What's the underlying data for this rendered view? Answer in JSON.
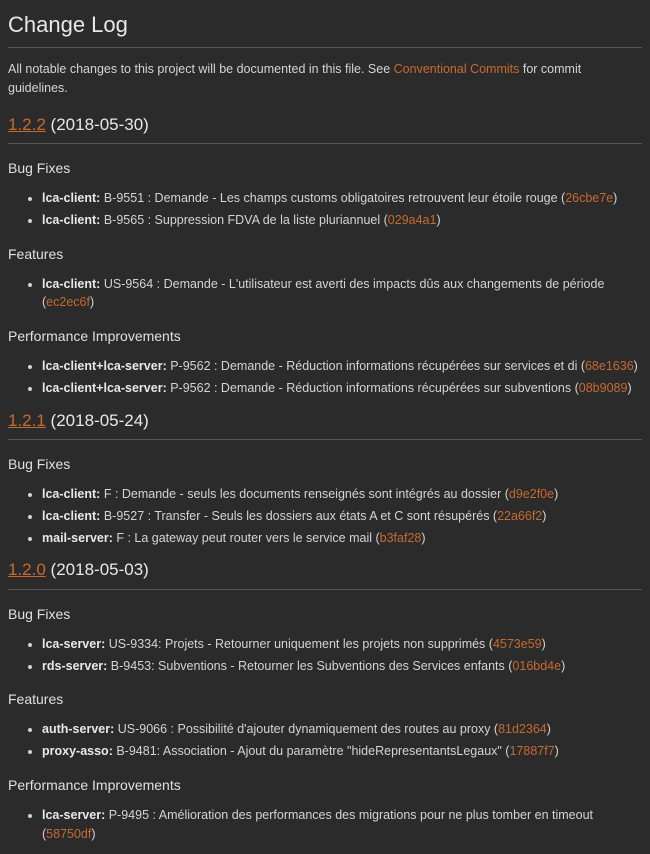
{
  "page_title": "Change Log",
  "intro": {
    "prefix": "All notable changes to this project will be documented in this file. See ",
    "link_label": "Conventional Commits",
    "suffix": " for commit guidelines."
  },
  "sections": {
    "bug_fixes": "Bug Fixes",
    "features": "Features",
    "perf": "Performance Improvements"
  },
  "releases": [
    {
      "version": "1.2.2",
      "date": "(2018-05-30)",
      "bug_fixes": [
        {
          "scope": "lca-client:",
          "text": " B-9551 : Demande - Les champs customs obligatoires retrouvent leur étoile rouge (",
          "hash": "26cbe7e",
          "close": ")"
        },
        {
          "scope": "lca-client:",
          "text": " B-9565 : Suppression FDVA de la liste pluriannuel (",
          "hash": "029a4a1",
          "close": ")"
        }
      ],
      "features": [
        {
          "scope": "lca-client:",
          "text": " US-9564 : Demande - L'utilisateur est averti des impacts dûs aux changements de période (",
          "hash": "ec2ec6f",
          "close": ")"
        }
      ],
      "perf": [
        {
          "scope": "lca-client+lca-server:",
          "text": " P-9562 : Demande - Réduction informations récupérées sur services et di (",
          "hash": "68e1636",
          "close": ")"
        },
        {
          "scope": "lca-client+lca-server:",
          "text": " P-9562 : Demande - Réduction informations récupérées sur subventions (",
          "hash": "08b9089",
          "close": ")"
        }
      ]
    },
    {
      "version": "1.2.1",
      "date": "(2018-05-24)",
      "bug_fixes": [
        {
          "scope": "lca-client:",
          "text": " F : Demande - seuls les documents renseignés sont intégrés au dossier (",
          "hash": "d9e2f0e",
          "close": ")"
        },
        {
          "scope": "lca-client:",
          "text": " B-9527 : Transfer - Seuls les dossiers aux états A et C sont résupérés (",
          "hash": "22a66f2",
          "close": ")"
        },
        {
          "scope": "mail-server:",
          "text": " F : La gateway peut router vers le service mail (",
          "hash": "b3faf28",
          "close": ")"
        }
      ]
    },
    {
      "version": "1.2.0",
      "date": "(2018-05-03)",
      "bug_fixes": [
        {
          "scope": "lca-server:",
          "text": " US-9334: Projets - Retourner uniquement les projets non supprimés (",
          "hash": "4573e59",
          "close": ")"
        },
        {
          "scope": "rds-server:",
          "text": " B-9453: Subventions - Retourner les Subventions des Services enfants (",
          "hash": "016bd4e",
          "close": ")"
        }
      ],
      "features": [
        {
          "scope": "auth-server:",
          "text": " US-9066 : Possibilité d'ajouter dynamiquement des routes au proxy (",
          "hash": "81d2364",
          "close": ")"
        },
        {
          "scope": "proxy-asso:",
          "text": " B-9481: Association - Ajout du paramètre \"hideRepresentantsLegaux\" (",
          "hash": "17887f7",
          "close": ")"
        }
      ],
      "perf": [
        {
          "scope": "lca-server:",
          "text": " P-9495 : Amélioration des performances des migrations pour ne plus tomber en timeout (",
          "hash": "58750df",
          "close": ")"
        }
      ]
    }
  ]
}
